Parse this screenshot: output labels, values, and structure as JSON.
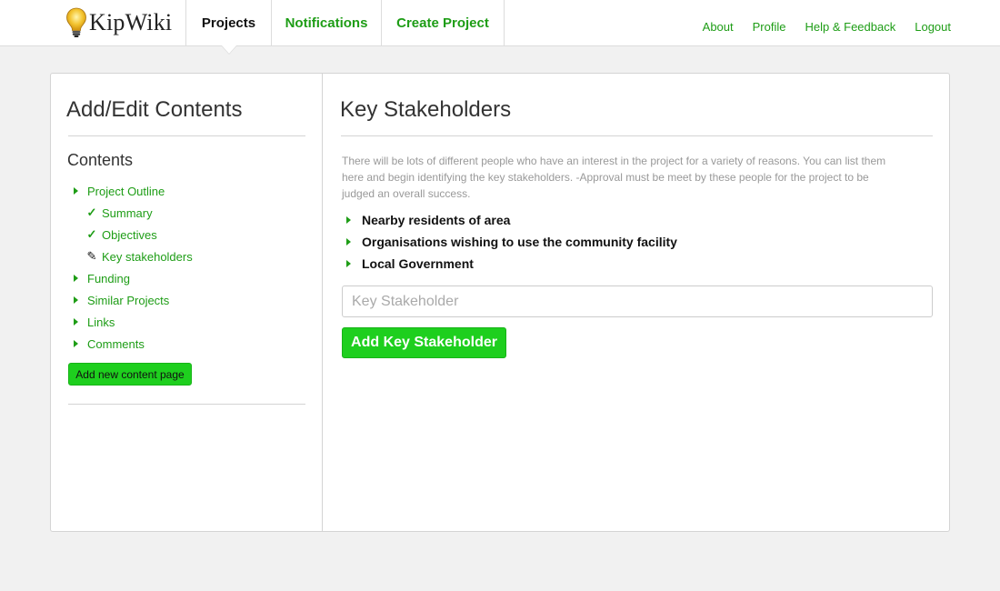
{
  "app": {
    "name": "KipWiki",
    "logo_icon": "lightbulb-icon"
  },
  "nav": {
    "tabs": [
      {
        "label": "Projects",
        "active": true
      },
      {
        "label": "Notifications",
        "active": false
      },
      {
        "label": "Create Project",
        "active": false
      }
    ],
    "links": [
      "About",
      "Profile",
      "Help & Feedback",
      "Logout"
    ]
  },
  "sidebar": {
    "title": "Add/Edit Contents",
    "contents_heading": "Contents",
    "items": [
      {
        "label": "Project Outline",
        "icon": "triangle-right-icon"
      },
      {
        "label": "Summary",
        "icon": "check-icon"
      },
      {
        "label": "Objectives",
        "icon": "check-icon"
      },
      {
        "label": "Key stakeholders",
        "icon": "pencil-icon"
      },
      {
        "label": "Funding",
        "icon": "triangle-right-icon"
      },
      {
        "label": "Similar Projects",
        "icon": "triangle-right-icon"
      },
      {
        "label": "Links",
        "icon": "triangle-right-icon"
      },
      {
        "label": "Comments",
        "icon": "triangle-right-icon"
      }
    ],
    "add_page_button": "Add new content page"
  },
  "main": {
    "title": "Key Stakeholders",
    "description": "There will be lots of different people who have an interest in the project for a variety of reasons. You can list them here and begin identifying the key stakeholders. -Approval must be meet by these people for the project to be judged an overall success.",
    "stakeholders": [
      "Nearby residents of area",
      "Organisations wishing to use the community facility",
      "Local Government"
    ],
    "input": {
      "placeholder": "Key Stakeholder",
      "value": ""
    },
    "add_button": "Add Key Stakeholder"
  },
  "colors": {
    "accent": "#1e9d16",
    "button": "#1ecf1e",
    "background": "#f1f1f1"
  }
}
